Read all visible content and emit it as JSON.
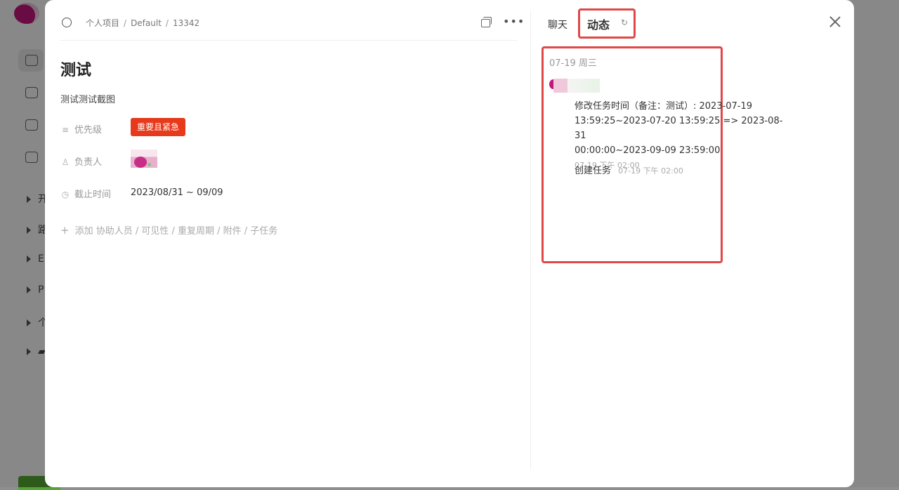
{
  "breadcrumb": [
    "个人项目",
    "Default",
    "13342"
  ],
  "task": {
    "title": "测试",
    "description": "测试测试截图",
    "fields": {
      "priority_label": "优先级",
      "priority_value": "重要且紧急",
      "assignee_label": "负责人",
      "deadline_label": "截止时间",
      "deadline_value": "2023/08/31 ~ 09/09"
    },
    "add_more": "添加 协助人员 / 可见性 / 重复周期 / 附件 / 子任务"
  },
  "panel": {
    "tabs": {
      "chat": "聊天",
      "activity": "动态"
    },
    "feed_date": "07-19 周三",
    "entries": [
      {
        "line1": "修改任务时间（备注：测试）: 2023-07-19",
        "line2": "13:59:25~2023-07-20 13:59:25 => 2023-08-31",
        "line3": "00:00:00~2023-09-09 23:59:00",
        "time": "07-19 下午 02:00"
      },
      {
        "text": "创建任务",
        "time": "07-19 下午 02:00"
      }
    ]
  },
  "colors": {
    "priority_tag": "#e7391b",
    "highlight": "#e04848"
  },
  "background_tree": [
    "开",
    "路",
    "E",
    "P",
    "个"
  ]
}
